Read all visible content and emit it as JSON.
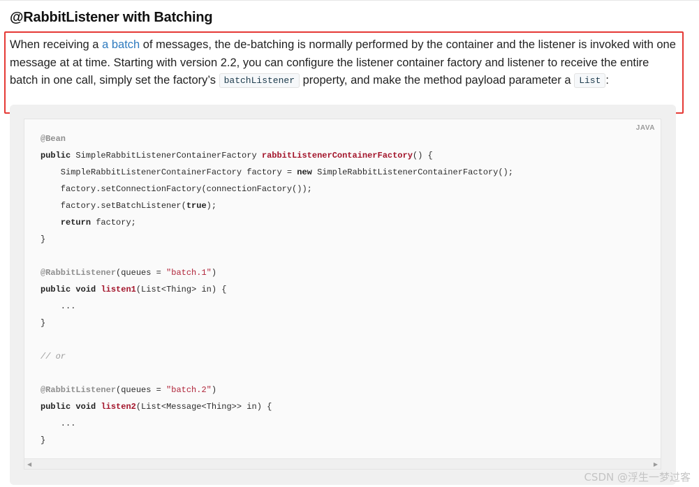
{
  "section": {
    "heading": "@RabbitListener with Batching",
    "paragraph": {
      "part1": "When receiving a ",
      "link": "a batch",
      "part2": " of messages, the de-batching is normally performed by the container and the listener is invoked with one message at at time. Starting with version 2.2, you can configure the listener container factory and listener to receive the entire batch in one call, simply set the factory’s ",
      "code1": "batchListener",
      "part3": " property, and make the method payload parameter a ",
      "code2": "List",
      "part4": ":"
    }
  },
  "listing": {
    "language": "JAVA",
    "lines": [
      [
        {
          "t": "ann",
          "v": "@Bean"
        }
      ],
      [
        {
          "t": "kw",
          "v": "public"
        },
        {
          "t": "",
          "v": " SimpleRabbitListenerContainerFactory "
        },
        {
          "t": "fn",
          "v": "rabbitListenerContainerFactory"
        },
        {
          "t": "",
          "v": "() {"
        }
      ],
      [
        {
          "t": "",
          "v": "    SimpleRabbitListenerContainerFactory factory = "
        },
        {
          "t": "kw",
          "v": "new"
        },
        {
          "t": "",
          "v": " SimpleRabbitListenerContainerFactory();"
        }
      ],
      [
        {
          "t": "",
          "v": "    factory.setConnectionFactory(connectionFactory());"
        }
      ],
      [
        {
          "t": "",
          "v": "    factory.setBatchListener("
        },
        {
          "t": "kw",
          "v": "true"
        },
        {
          "t": "",
          "v": ");"
        }
      ],
      [
        {
          "t": "",
          "v": "    "
        },
        {
          "t": "kw",
          "v": "return"
        },
        {
          "t": "",
          "v": " factory;"
        }
      ],
      [
        {
          "t": "",
          "v": "}"
        }
      ],
      [],
      [
        {
          "t": "ann",
          "v": "@RabbitListener"
        },
        {
          "t": "",
          "v": "(queues = "
        },
        {
          "t": "str",
          "v": "\"batch.1\""
        },
        {
          "t": "",
          "v": ")"
        }
      ],
      [
        {
          "t": "kw",
          "v": "public"
        },
        {
          "t": "",
          "v": " "
        },
        {
          "t": "kw",
          "v": "void"
        },
        {
          "t": "",
          "v": " "
        },
        {
          "t": "fn",
          "v": "listen1"
        },
        {
          "t": "",
          "v": "(List<Thing> in) {"
        }
      ],
      [
        {
          "t": "",
          "v": "    ..."
        }
      ],
      [
        {
          "t": "",
          "v": "}"
        }
      ],
      [],
      [
        {
          "t": "cm",
          "v": "// or"
        }
      ],
      [],
      [
        {
          "t": "ann",
          "v": "@RabbitListener"
        },
        {
          "t": "",
          "v": "(queues = "
        },
        {
          "t": "str",
          "v": "\"batch.2\""
        },
        {
          "t": "",
          "v": ")"
        }
      ],
      [
        {
          "t": "kw",
          "v": "public"
        },
        {
          "t": "",
          "v": " "
        },
        {
          "t": "kw",
          "v": "void"
        },
        {
          "t": "",
          "v": " "
        },
        {
          "t": "fn",
          "v": "listen2"
        },
        {
          "t": "",
          "v": "(List<Message<Thing>> in) {"
        }
      ],
      [
        {
          "t": "",
          "v": "    ..."
        }
      ],
      [
        {
          "t": "",
          "v": "}"
        }
      ]
    ]
  },
  "watermark": "CSDN @浮生一梦过客"
}
